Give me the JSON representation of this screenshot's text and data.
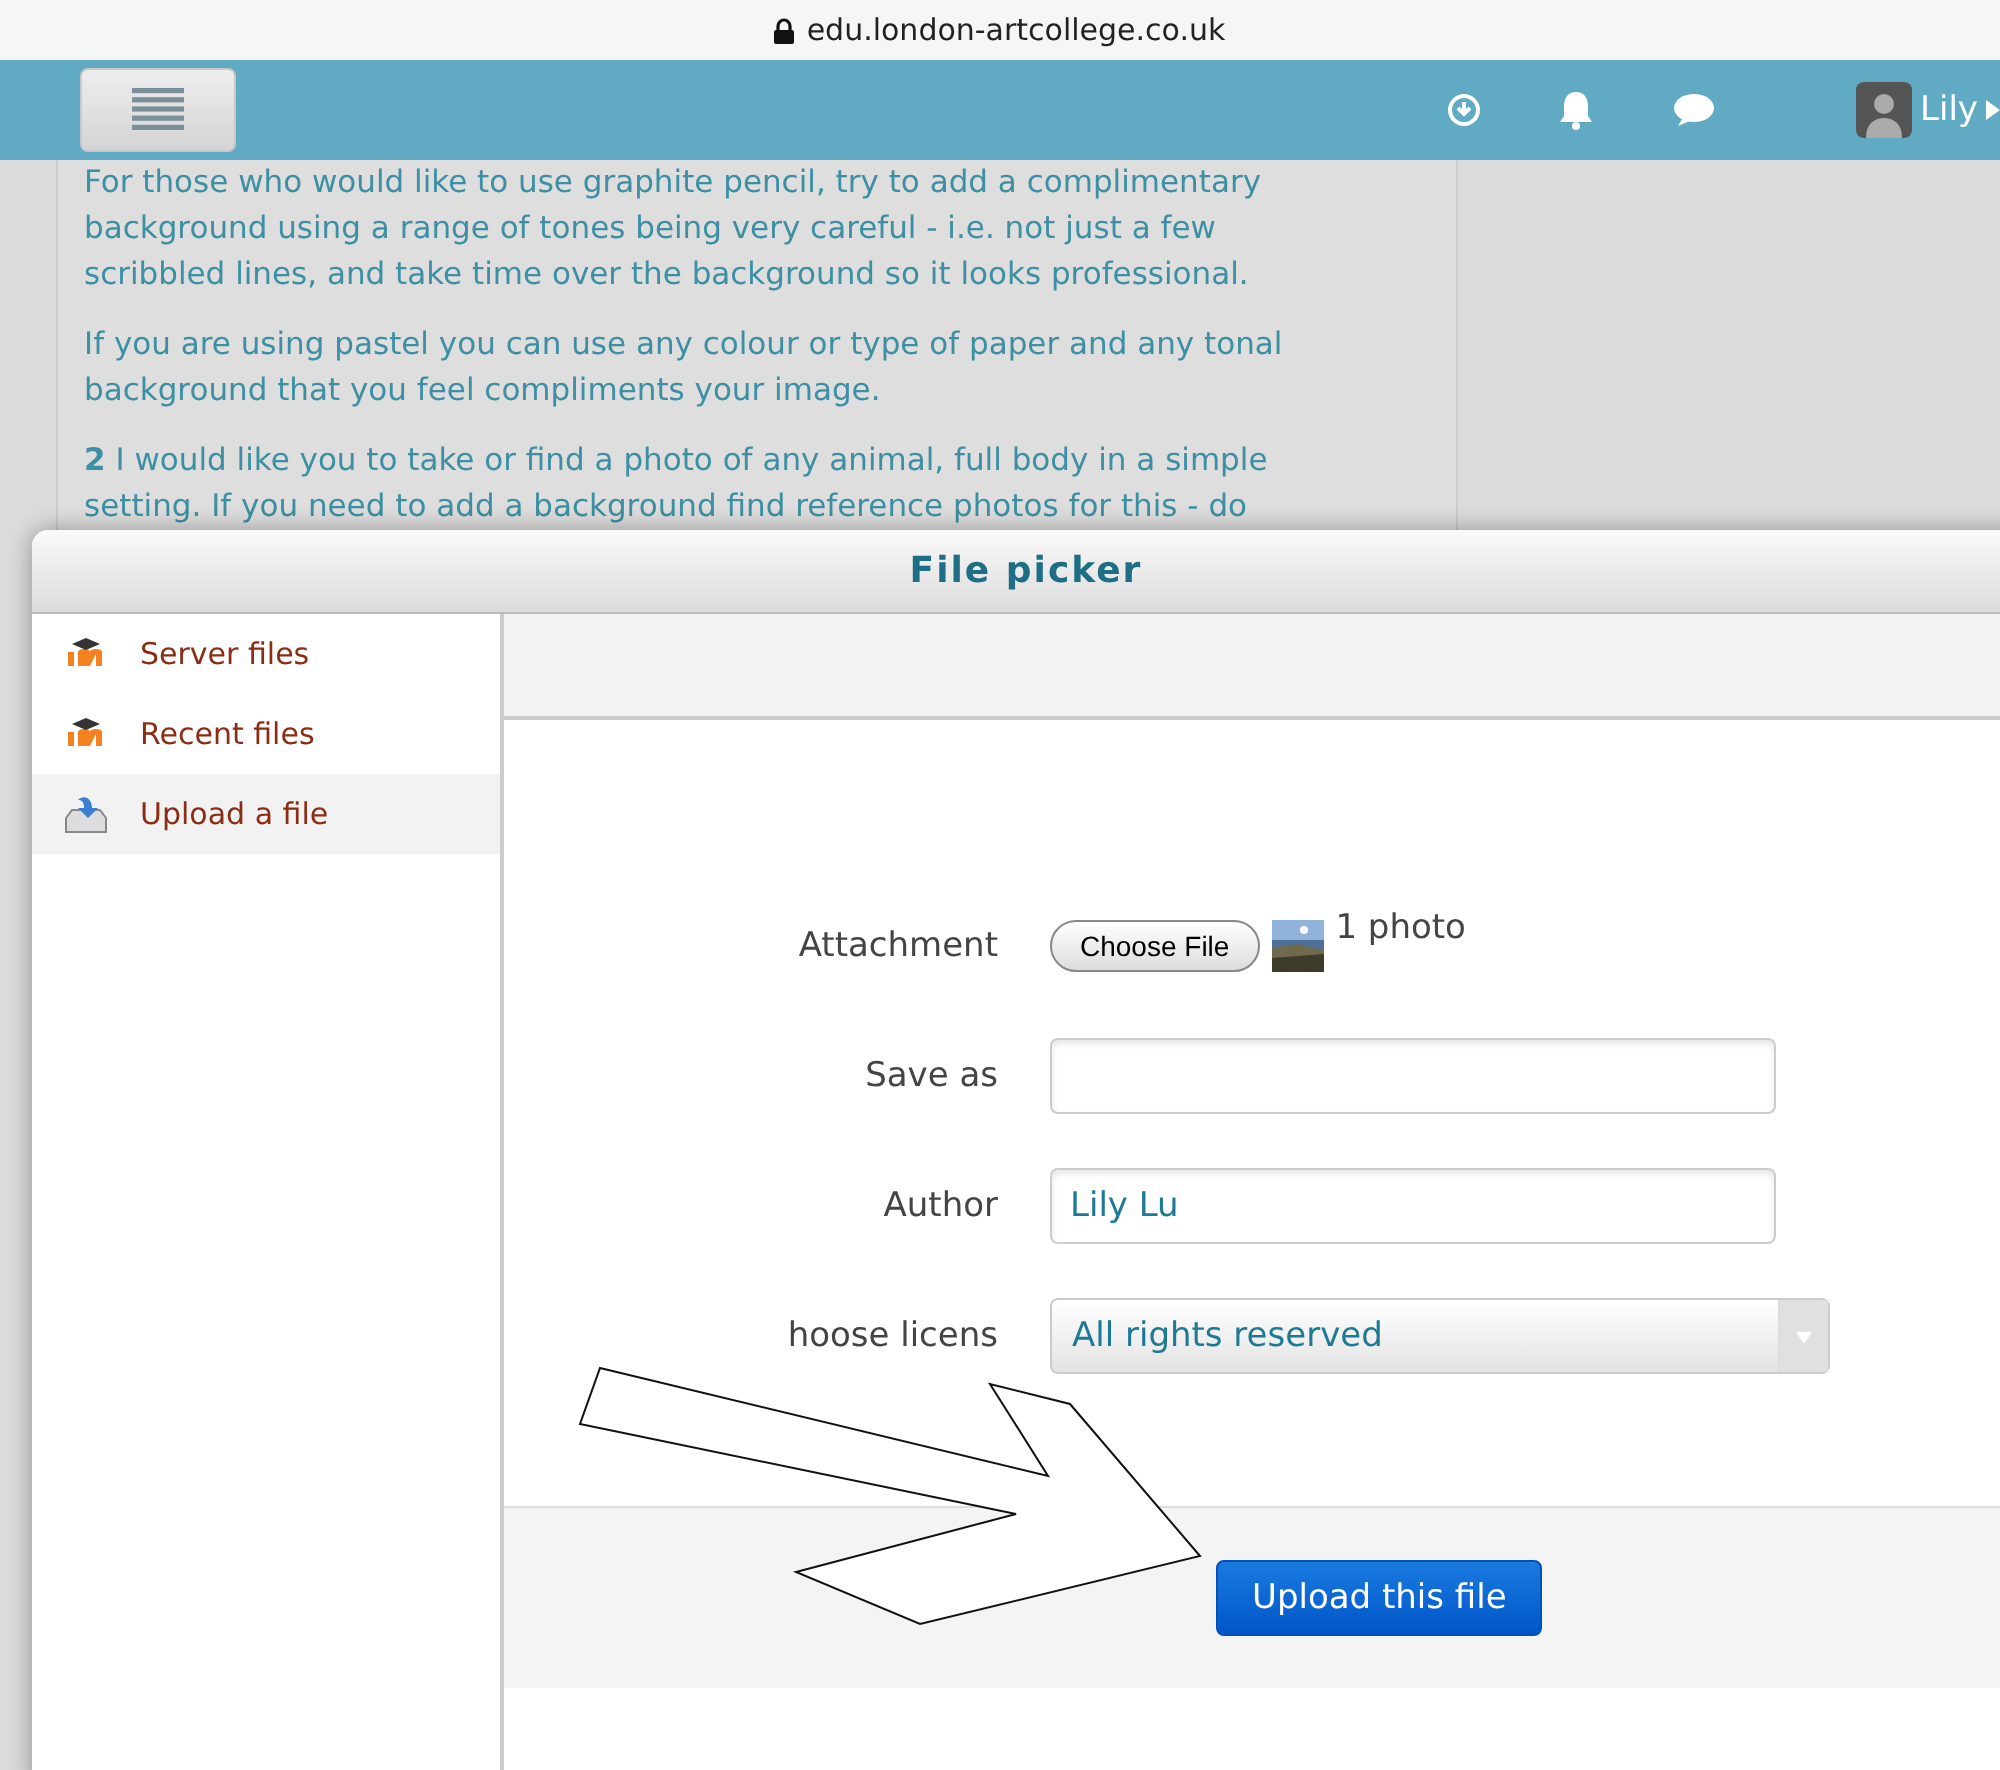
{
  "browser": {
    "address": "edu.london-artcollege.co.uk"
  },
  "header": {
    "user": "Lily"
  },
  "content": {
    "paragraphs": [
      {
        "lines": [
          "For those who would like to use graphite pencil, try to add a complimentary",
          "background using a range of tones being very careful - i.e. not just a few",
          "scribbled lines, and take time over the background so it looks professional."
        ]
      },
      {
        "lines": [
          "If you are using pastel you can use any colour or type of paper and any tonal",
          "background that you feel compliments your image."
        ]
      },
      {
        "lines": [
          "**2** I would like you to take or find a photo of any animal, full body in a simple",
          "setting. If you need to add a background find reference photos for this - do"
        ]
      }
    ]
  },
  "dialog": {
    "title": "File picker",
    "sources": [
      {
        "label": "Server files",
        "kind": "moodle",
        "selected": false
      },
      {
        "label": "Recent files",
        "kind": "moodle",
        "selected": false
      },
      {
        "label": "Upload a file",
        "kind": "upload",
        "selected": true
      }
    ],
    "form": {
      "attachment": {
        "label": "Attachment",
        "button": "Choose File",
        "file": "1 photo"
      },
      "save_as": {
        "label": "Save as"
      },
      "author": {
        "label": "Author",
        "value": "Lily Lu"
      },
      "license": {
        "label": "hoose licens",
        "value": "All rights reserved"
      }
    },
    "submit": "Upload this file"
  }
}
